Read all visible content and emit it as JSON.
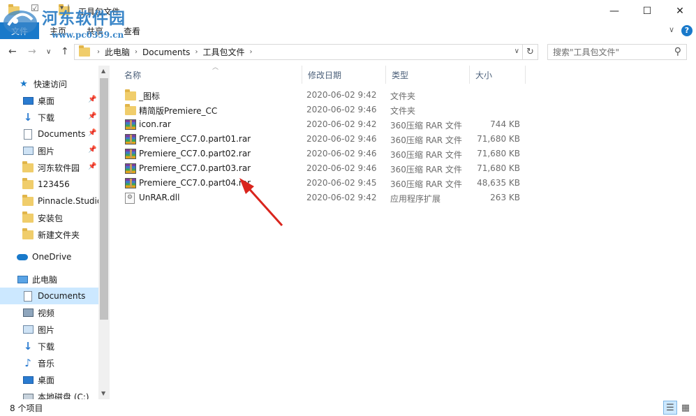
{
  "window": {
    "title": "工具包文件",
    "minimize": "—",
    "maximize": "☐",
    "close": "✕"
  },
  "watermark": {
    "title": "河东软件园",
    "url": "www.pc0359.cn"
  },
  "ribbon": {
    "file_tab": "文件",
    "tabs": [
      "主页",
      "共享",
      "查看"
    ],
    "expand_glyph": "∨",
    "help_glyph": "?"
  },
  "nav": {
    "back": "←",
    "forward": "→",
    "recent": "∨",
    "up": "↑",
    "breadcrumb": [
      "此电脑",
      "Documents",
      "工具包文件"
    ],
    "refresh": "↻",
    "search_placeholder": "搜索\"工具包文件\""
  },
  "sidebar": {
    "quick_access_label": "快速访问",
    "quick_access": [
      {
        "label": "桌面",
        "icon": "desktop-icon",
        "pinned": true
      },
      {
        "label": "下载",
        "icon": "download-icon",
        "pinned": true
      },
      {
        "label": "Documents",
        "icon": "documents-icon",
        "pinned": true
      },
      {
        "label": "图片",
        "icon": "pictures-icon",
        "pinned": true
      },
      {
        "label": "河东软件园",
        "icon": "folder-icon",
        "pinned": true
      },
      {
        "label": "123456",
        "icon": "folder-icon",
        "pinned": false
      },
      {
        "label": "Pinnacle.Studio",
        "icon": "folder-icon",
        "pinned": false
      },
      {
        "label": "安装包",
        "icon": "folder-icon",
        "pinned": false
      },
      {
        "label": "新建文件夹",
        "icon": "folder-icon",
        "pinned": false
      }
    ],
    "onedrive_label": "OneDrive",
    "this_pc_label": "此电脑",
    "this_pc": [
      {
        "label": "Documents",
        "icon": "documents-icon",
        "selected": true
      },
      {
        "label": "视频",
        "icon": "videos-icon"
      },
      {
        "label": "图片",
        "icon": "pictures-icon"
      },
      {
        "label": "下载",
        "icon": "download-icon"
      },
      {
        "label": "音乐",
        "icon": "music-icon"
      },
      {
        "label": "桌面",
        "icon": "desktop-icon"
      },
      {
        "label": "本地磁盘 (C:)",
        "icon": "drive-icon"
      }
    ]
  },
  "columns": {
    "name": "名称",
    "date": "修改日期",
    "type": "类型",
    "size": "大小"
  },
  "files": [
    {
      "name": "_图标",
      "date": "2020-06-02 9:42",
      "type": "文件夹",
      "size": "",
      "icon": "folder-icon"
    },
    {
      "name": "精简版Premiere_CC",
      "date": "2020-06-02 9:46",
      "type": "文件夹",
      "size": "",
      "icon": "folder-icon"
    },
    {
      "name": "icon.rar",
      "date": "2020-06-02 9:42",
      "type": "360压缩 RAR 文件",
      "size": "744 KB",
      "icon": "rar-icon"
    },
    {
      "name": "Premiere_CC7.0.part01.rar",
      "date": "2020-06-02 9:46",
      "type": "360压缩 RAR 文件",
      "size": "71,680 KB",
      "icon": "rar-icon"
    },
    {
      "name": "Premiere_CC7.0.part02.rar",
      "date": "2020-06-02 9:46",
      "type": "360压缩 RAR 文件",
      "size": "71,680 KB",
      "icon": "rar-icon"
    },
    {
      "name": "Premiere_CC7.0.part03.rar",
      "date": "2020-06-02 9:46",
      "type": "360压缩 RAR 文件",
      "size": "71,680 KB",
      "icon": "rar-icon"
    },
    {
      "name": "Premiere_CC7.0.part04.rar",
      "date": "2020-06-02 9:45",
      "type": "360压缩 RAR 文件",
      "size": "48,635 KB",
      "icon": "rar-icon"
    },
    {
      "name": "UnRAR.dll",
      "date": "2020-06-02 9:42",
      "type": "应用程序扩展",
      "size": "263 KB",
      "icon": "dll-icon"
    }
  ],
  "status": {
    "count": "8 个项目"
  },
  "colors": {
    "accent": "#1979ca",
    "selected_bg": "#cce8ff",
    "annotation_arrow": "#d9251d"
  }
}
